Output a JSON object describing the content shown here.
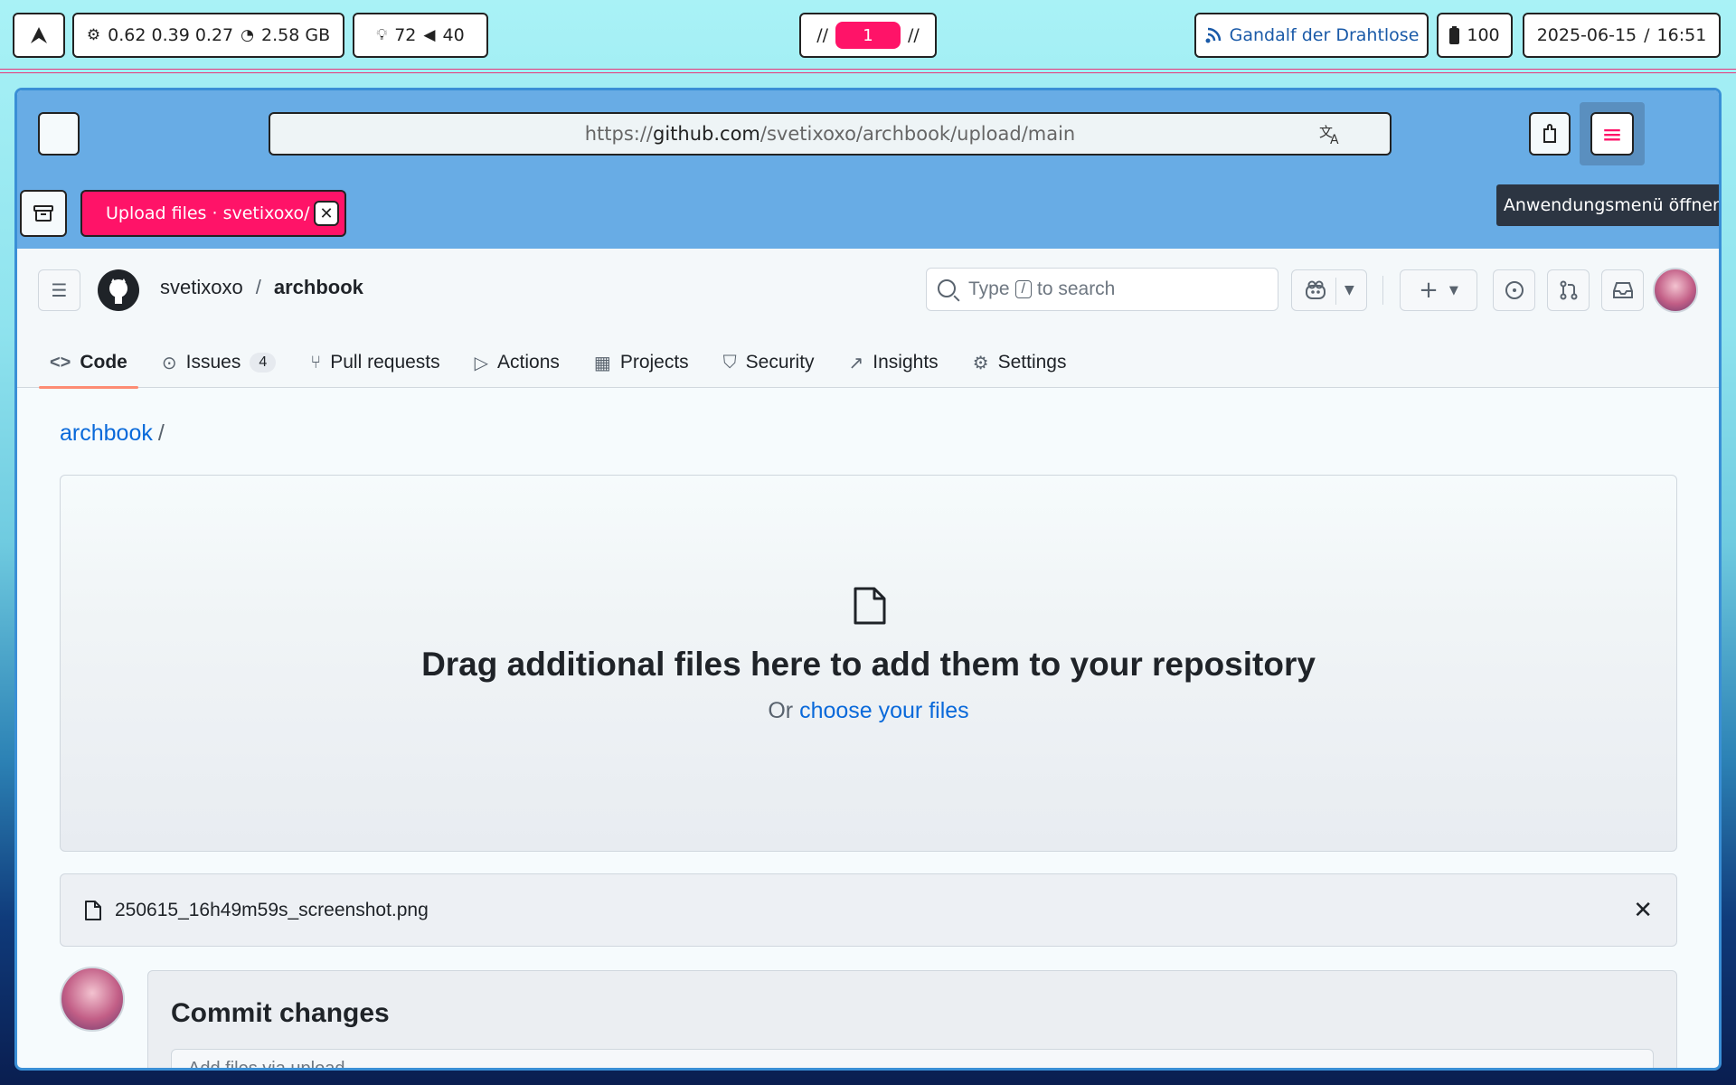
{
  "statusbar": {
    "launcher_icon": "arch-logo-icon",
    "load": "0.62 0.39 0.27",
    "memory": "2.58 GB",
    "brightness": "72",
    "volume": "40",
    "workspace_left": "//",
    "workspace_active": "1",
    "workspace_right": "//",
    "wifi_name": "Gandalf der Drahtlose",
    "battery": "100",
    "date": "2025-06-15",
    "date_sep": "/",
    "time": "16:51"
  },
  "browser": {
    "url_scheme": "https://",
    "url_host": "github.com",
    "url_path": "/svetixoxo/archbook/upload/main",
    "tab_title": "Upload files · svetixoxo/archbook",
    "tooltip": "Anwendungsmenü öffnen"
  },
  "github": {
    "owner": "svetixoxo",
    "crumb_sep": "/",
    "repo": "archbook",
    "search_prefix": "Type",
    "search_key": "/",
    "search_suffix": "to search",
    "nav": [
      {
        "label": "Code",
        "icon": "code-icon"
      },
      {
        "label": "Issues",
        "icon": "issue-opened-icon",
        "count": "4"
      },
      {
        "label": "Pull requests",
        "icon": "git-pull-request-icon"
      },
      {
        "label": "Actions",
        "icon": "play-icon"
      },
      {
        "label": "Projects",
        "icon": "table-icon"
      },
      {
        "label": "Security",
        "icon": "shield-icon"
      },
      {
        "label": "Insights",
        "icon": "graph-icon"
      },
      {
        "label": "Settings",
        "icon": "gear-icon"
      }
    ],
    "breadcrumb_repo": "archbook",
    "breadcrumb_sep": "/",
    "dropzone_title": "Drag additional files here to add them to your repository",
    "dropzone_or": "Or",
    "dropzone_link": "choose your files",
    "file_name": "250615_16h49m59s_screenshot.png",
    "commit_title": "Commit changes",
    "commit_placeholder": "Add files via upload"
  }
}
